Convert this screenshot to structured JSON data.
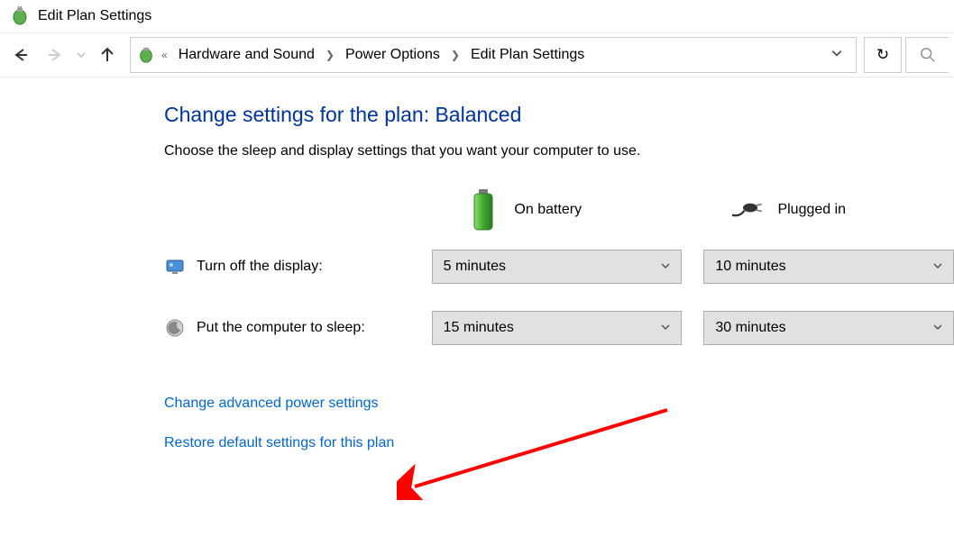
{
  "window": {
    "title": "Edit Plan Settings"
  },
  "breadcrumb": {
    "prefix": "«",
    "items": [
      "Hardware and Sound",
      "Power Options",
      "Edit Plan Settings"
    ]
  },
  "page": {
    "heading": "Change settings for the plan: Balanced",
    "subtitle": "Choose the sleep and display settings that you want your computer to use."
  },
  "columns": {
    "battery": "On battery",
    "plugged": "Plugged in"
  },
  "rows": [
    {
      "label": "Turn off the display:",
      "battery_value": "5 minutes",
      "plugged_value": "10 minutes"
    },
    {
      "label": "Put the computer to sleep:",
      "battery_value": "15 minutes",
      "plugged_value": "30 minutes"
    }
  ],
  "links": {
    "advanced": "Change advanced power settings",
    "restore": "Restore default settings for this plan"
  }
}
